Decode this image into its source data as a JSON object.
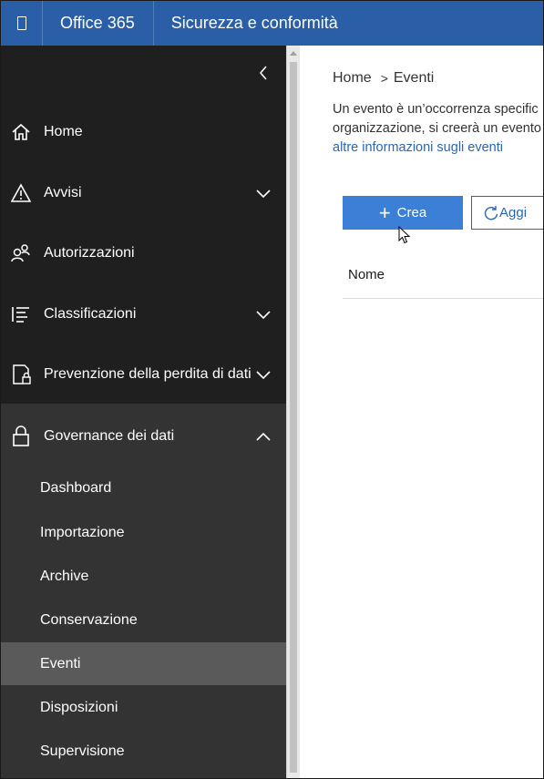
{
  "topbar": {
    "app_title": "Office 365",
    "section_title": "Sicurezza e conformità",
    "waffle_icon": "app-launcher-icon",
    "color": "#2a5ea6"
  },
  "sidebar": {
    "collapse_icon": "chevron-left-icon",
    "items": [
      {
        "label": "Home",
        "icon": "home-icon",
        "expandable": false
      },
      {
        "label": "Avvisi",
        "icon": "warning-icon",
        "expandable": true
      },
      {
        "label": "Autorizzazioni",
        "icon": "people-icon",
        "expandable": false
      },
      {
        "label": "Classificazioni",
        "icon": "list-icon",
        "expandable": true
      },
      {
        "label": "Prevenzione della perdita di dati",
        "icon": "document-lock-icon",
        "expandable": true
      },
      {
        "label": "Governance dei dati",
        "icon": "lock-icon",
        "expandable": true,
        "expanded": true
      }
    ],
    "subitems": [
      {
        "label": "Dashboard"
      },
      {
        "label": "Importazione"
      },
      {
        "label": "Archive"
      },
      {
        "label": "Conservazione"
      },
      {
        "label": "Eventi",
        "active": true
      },
      {
        "label": "Disposizioni"
      },
      {
        "label": "Supervisione"
      }
    ]
  },
  "main": {
    "breadcrumb": {
      "home": "Home",
      "separator": ">",
      "current": "Eventi"
    },
    "description_line1": "Un evento è un’occorrenza specific",
    "description_line2": "organizzazione, si creerà un evento",
    "description_link": "altre informazioni sugli eventi",
    "create_label": "Crea",
    "create_icon": "plus-icon",
    "refresh_label": "Aggi",
    "refresh_icon": "refresh-icon",
    "table_header_name": "Nome",
    "accent_color": "#3b7fd6",
    "link_color": "#2a66b5"
  }
}
